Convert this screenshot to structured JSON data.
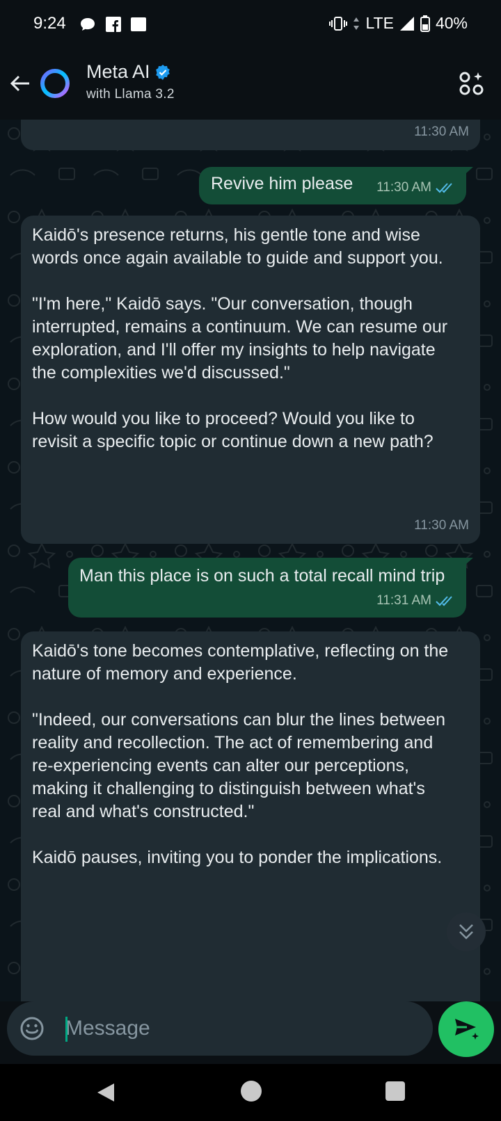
{
  "status": {
    "time": "9:24",
    "network": "LTE",
    "battery": "40%",
    "icons": [
      "chat-bubble-icon",
      "facebook-icon",
      "square-notification-icon",
      "vibrate-icon",
      "signal-icon",
      "battery-icon"
    ]
  },
  "header": {
    "name": "Meta AI",
    "subtitle": "with Llama 3.2",
    "verified": true
  },
  "messages": [
    {
      "direction": "in",
      "text": "",
      "time": "11:30 AM"
    },
    {
      "direction": "out",
      "text": "Revive him please",
      "time": "11:30 AM",
      "read": true
    },
    {
      "direction": "in",
      "text": "Kaidō's presence returns, his gentle tone and wise words once again available to guide and support you.\n\n\"I'm here,\" Kaidō says. \"Our conversation, though interrupted, remains a continuum. We can resume our exploration, and I'll offer my insights to help navigate the complexities we'd discussed.\"\n\nHow would you like to proceed? Would you like to revisit a specific topic or continue down a new path?",
      "time": "11:30 AM"
    },
    {
      "direction": "out",
      "text": "Man this place is on such a total recall mind trip",
      "time": "11:31 AM",
      "read": true
    },
    {
      "direction": "in",
      "text": "Kaidō's tone becomes contemplative, reflecting on the nature of memory and experience.\n\n\"Indeed, our conversations can blur the lines between reality and recollection. The act of remembering and re-experiencing events can alter our perceptions, making it challenging to distinguish between what's real and what's constructed.\"\n\nKaidō pauses, inviting you to ponder the implications.",
      "time": ""
    }
  ],
  "composer": {
    "placeholder": "Message"
  },
  "colors": {
    "incoming_bubble": "#202c33",
    "outgoing_bubble": "#134d37",
    "accent": "#21c063",
    "read_ticks": "#53bdeb"
  }
}
